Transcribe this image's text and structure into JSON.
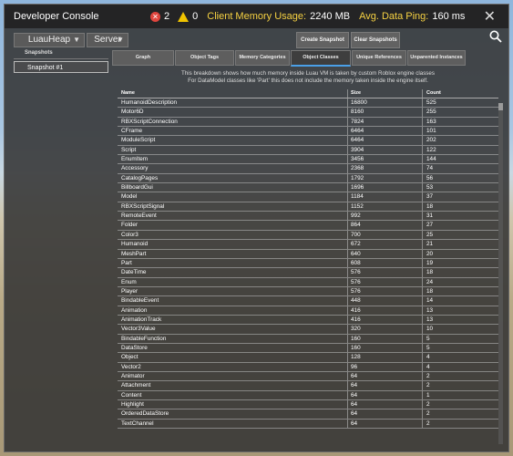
{
  "window": {
    "title": "Developer Console",
    "error_count": "2",
    "warning_count": "0",
    "memory_label": "Client Memory Usage:",
    "memory_value": "2240 MB",
    "ping_label": "Avg. Data Ping:",
    "ping_value": "160 ms",
    "close_glyph": "✕"
  },
  "controls": {
    "view_dropdown": "LuauHeap",
    "context_dropdown": "Server",
    "create_snapshot": "Create Snapshot",
    "clear_snapshots": "Clear Snapshots"
  },
  "snapshots": {
    "header": "Snapshots",
    "items": [
      "Snapshot #1"
    ]
  },
  "tabs": [
    "Graph",
    "Object Tags",
    "Memory Categories",
    "Object Classes",
    "Unique References",
    "Unparented Instances"
  ],
  "active_tab": "Object Classes",
  "description": {
    "line1": "This breakdown shows how much memory inside Luau VM is taken by custom Roblox engine classes",
    "line2": "For DataModel classes like 'Part' this does not include the memory taken inside the engine itself."
  },
  "table": {
    "columns": [
      "Name",
      "Size",
      "Count"
    ],
    "rows": [
      [
        "HumanoidDescription",
        "16800",
        "525"
      ],
      [
        "Motor6D",
        "8160",
        "255"
      ],
      [
        "RBXScriptConnection",
        "7824",
        "163"
      ],
      [
        "CFrame",
        "6464",
        "101"
      ],
      [
        "ModuleScript",
        "6464",
        "202"
      ],
      [
        "Script",
        "3904",
        "122"
      ],
      [
        "EnumItem",
        "3456",
        "144"
      ],
      [
        "Accessory",
        "2368",
        "74"
      ],
      [
        "CatalogPages",
        "1792",
        "56"
      ],
      [
        "BillboardGui",
        "1696",
        "53"
      ],
      [
        "Model",
        "1184",
        "37"
      ],
      [
        "RBXScriptSignal",
        "1152",
        "18"
      ],
      [
        "RemoteEvent",
        "992",
        "31"
      ],
      [
        "Folder",
        "864",
        "27"
      ],
      [
        "Color3",
        "700",
        "25"
      ],
      [
        "Humanoid",
        "672",
        "21"
      ],
      [
        "MeshPart",
        "640",
        "20"
      ],
      [
        "Part",
        "608",
        "19"
      ],
      [
        "DateTime",
        "576",
        "18"
      ],
      [
        "Enum",
        "576",
        "24"
      ],
      [
        "Player",
        "576",
        "18"
      ],
      [
        "BindableEvent",
        "448",
        "14"
      ],
      [
        "Animation",
        "416",
        "13"
      ],
      [
        "AnimationTrack",
        "416",
        "13"
      ],
      [
        "Vector3Value",
        "320",
        "10"
      ],
      [
        "BindableFunction",
        "160",
        "5"
      ],
      [
        "DataStore",
        "160",
        "5"
      ],
      [
        "Object",
        "128",
        "4"
      ],
      [
        "Vector2",
        "96",
        "4"
      ],
      [
        "Animator",
        "64",
        "2"
      ],
      [
        "Attachment",
        "64",
        "2"
      ],
      [
        "Content",
        "64",
        "1"
      ],
      [
        "Highlight",
        "64",
        "2"
      ],
      [
        "OrderedDataStore",
        "64",
        "2"
      ],
      [
        "TextChannel",
        "64",
        "2"
      ]
    ]
  },
  "colors": {
    "error": "#e0453d",
    "warning": "#f0c300",
    "highlight_text": "#f5d142",
    "active_tab_accent": "#4aa0e8"
  }
}
